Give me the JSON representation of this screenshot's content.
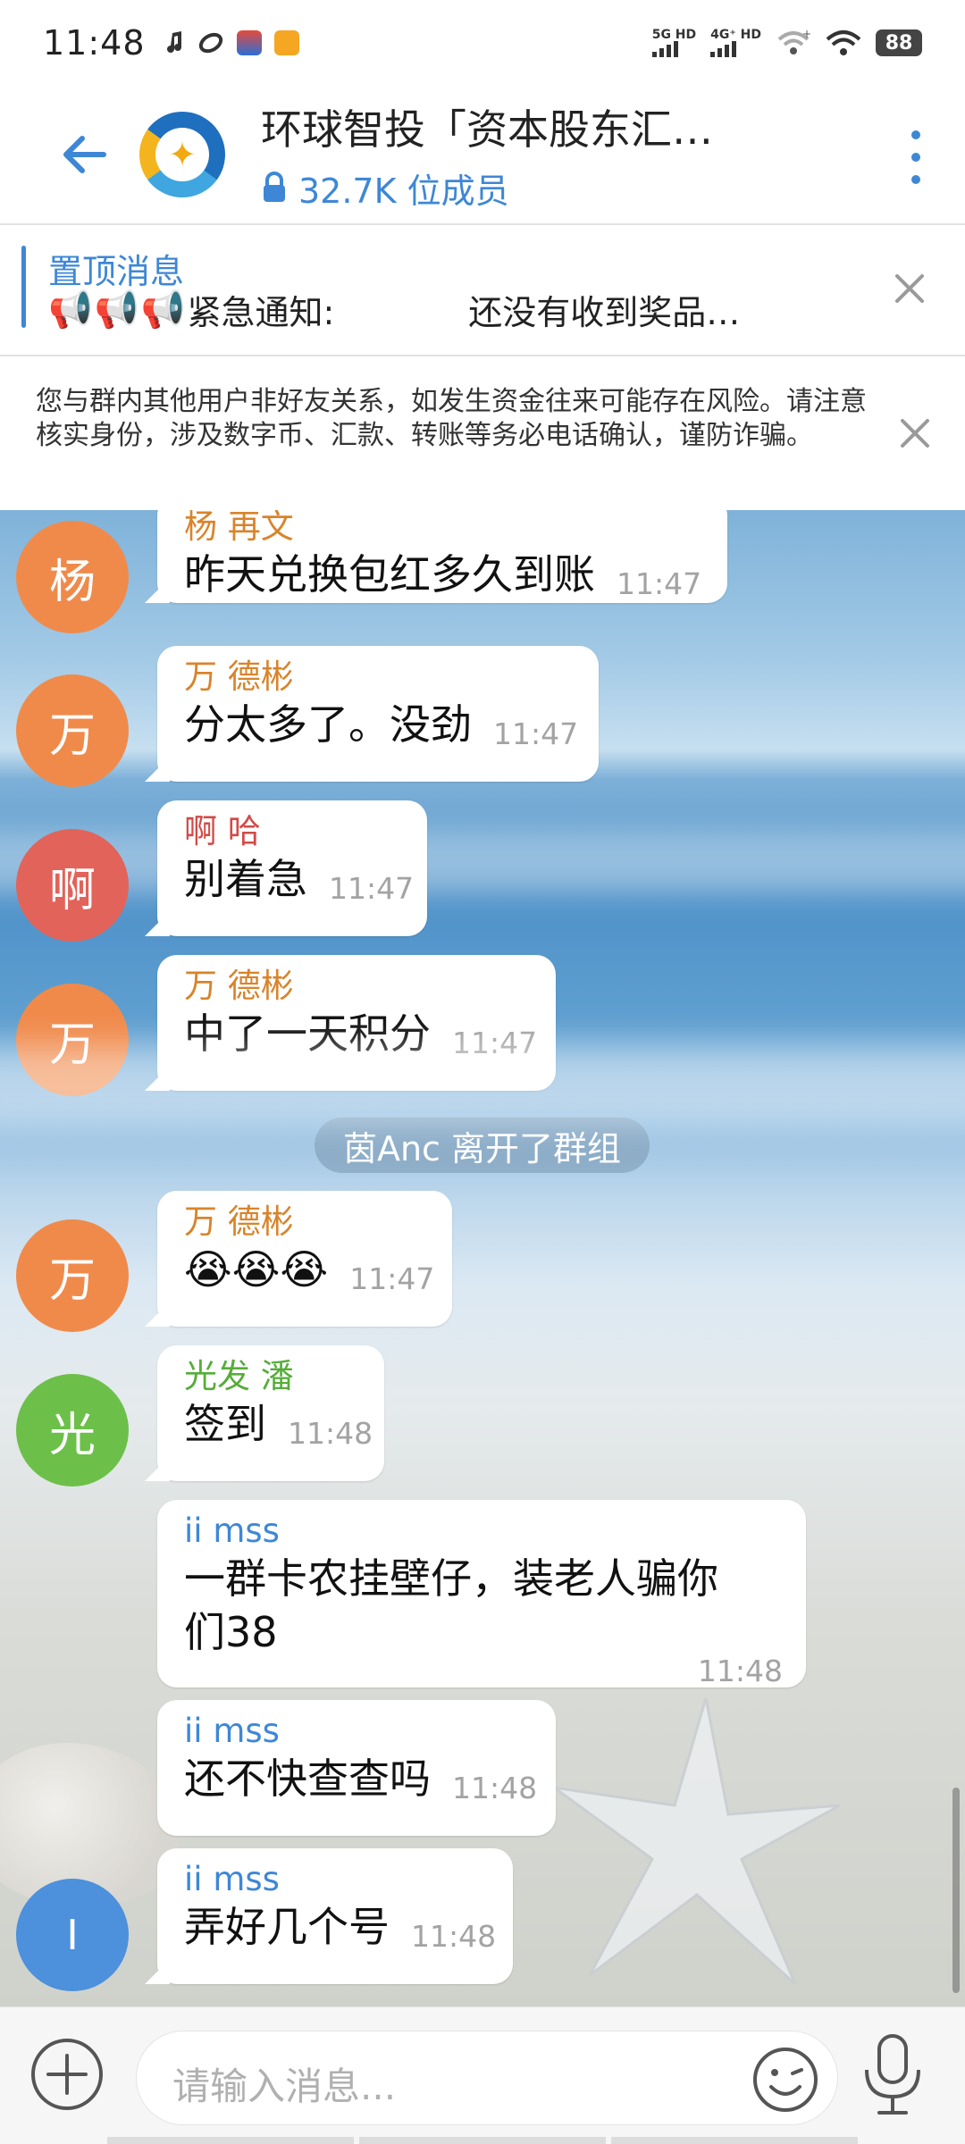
{
  "status_bar": {
    "time": "11:48",
    "net1": "5G HD",
    "net2": "4G⁺ HD",
    "battery": "88"
  },
  "header": {
    "title": "环球智投「资本股东汇…",
    "members": "32.7K 位成员"
  },
  "pinned": {
    "title": "置顶消息",
    "text": "紧急通知:",
    "text2": "还没有收到奖品…"
  },
  "warning": {
    "text": "您与群内其他用户非好友关系，如发生资金往来可能存在风险。请注意核实身份，涉及数字币、汇款、转账等务必电话确认，谨防诈骗。"
  },
  "messages": [
    {
      "avatar": "杨",
      "avatar_color": "#f08a4b",
      "sender": "杨 再文",
      "sender_color": "#d8842b",
      "text": "昨天兑换包红多久到账",
      "time": "11:47"
    },
    {
      "avatar": "万",
      "avatar_color": "#f08a4b",
      "sender": "万 德彬",
      "sender_color": "#d8842b",
      "text": "分太多了。没劲",
      "time": "11:47"
    },
    {
      "avatar": "啊",
      "avatar_color": "#e2635a",
      "sender": "啊 哈",
      "sender_color": "#d24a47",
      "text": "别着急",
      "time": "11:47"
    },
    {
      "avatar": "万",
      "avatar_color": "#f08a4b",
      "sender": "万 德彬",
      "sender_color": "#d8842b",
      "text": "中了一天积分",
      "time": "11:47"
    },
    {
      "avatar": "万",
      "avatar_color": "#f08a4b",
      "sender": "万 德彬",
      "sender_color": "#d8842b",
      "text": "😭😭😭",
      "time": "11:47"
    },
    {
      "avatar": "光",
      "avatar_color": "#6cc04a",
      "sender": "光发 潘",
      "sender_color": "#56ad3a",
      "text": "签到",
      "time": "11:48"
    },
    {
      "sender": "ii mss",
      "sender_color": "#3e87d6",
      "text": "一群卡农挂壁仔，装老人骗你们38",
      "time": "11:48"
    },
    {
      "sender": "ii mss",
      "sender_color": "#3e87d6",
      "text": "还不快查查吗",
      "time": "11:48"
    },
    {
      "avatar": "I",
      "avatar_color": "#4d90dc",
      "sender": "ii mss",
      "sender_color": "#3e87d6",
      "text": "弄好几个号",
      "time": "11:48"
    }
  ],
  "service_message": "茵Anc 离开了群组",
  "input": {
    "placeholder": "请输入消息..."
  },
  "colors": {
    "accent": "#3e87d6",
    "divider": "#e3e3e3"
  }
}
